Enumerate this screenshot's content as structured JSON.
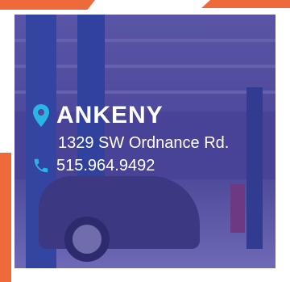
{
  "location": {
    "city": "ANKENY",
    "address": "1329 SW Ordnance Rd.",
    "phone": "515.964.9492"
  },
  "icons": {
    "location": "map-pin-icon",
    "phone": "phone-icon"
  },
  "colors": {
    "accent": "#ee6a3a",
    "overlay": "#4f4a97",
    "icon": "#29b6e6",
    "text": "#ffffff"
  }
}
